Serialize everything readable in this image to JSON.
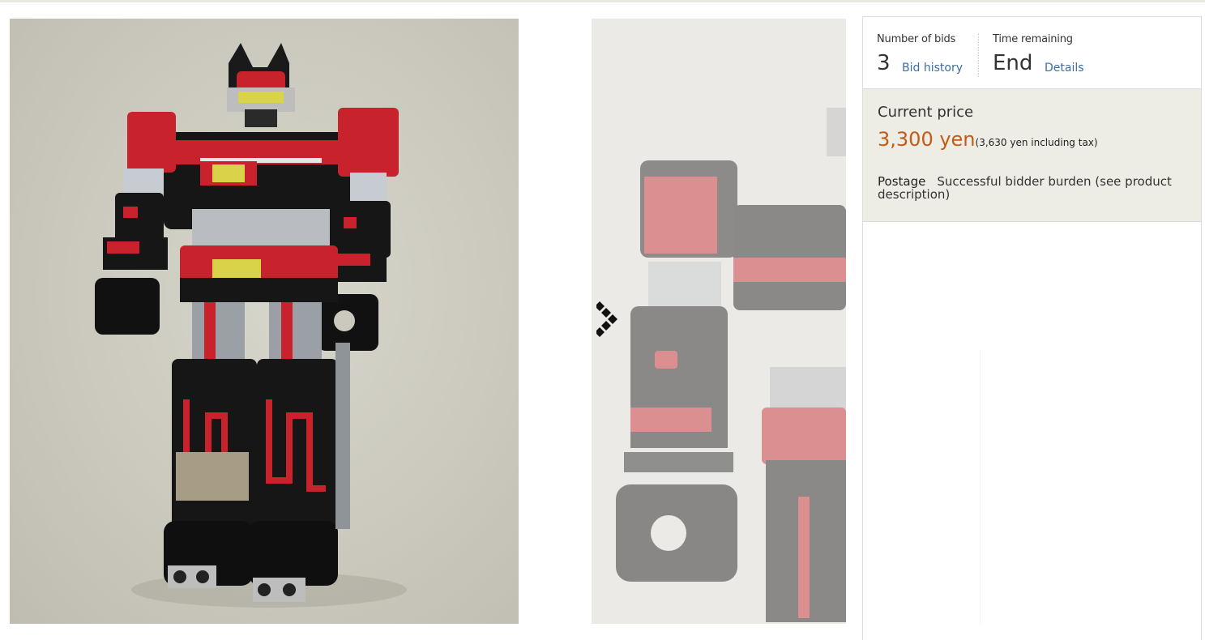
{
  "auction": {
    "bids_label": "Number of bids",
    "bids_value": "3",
    "bid_history_link": "Bid history",
    "time_label": "Time remaining",
    "time_value": "End",
    "details_link": "Details"
  },
  "price": {
    "label": "Current price",
    "value": "3,300 yen",
    "tax_note": "(3,630 yen including tax)",
    "postage_label": "Postage",
    "postage_value": "Successful bidder burden (see product description)"
  },
  "gallery": {
    "main_image_icon": "robot-toy-photo",
    "second_image_icon": "robot-toy-closeup-photo",
    "next_icon": "chevron-right-icon"
  },
  "colors": {
    "price": "#c65a15",
    "link": "#3a6ea5",
    "price_box_bg": "#eeede5"
  }
}
